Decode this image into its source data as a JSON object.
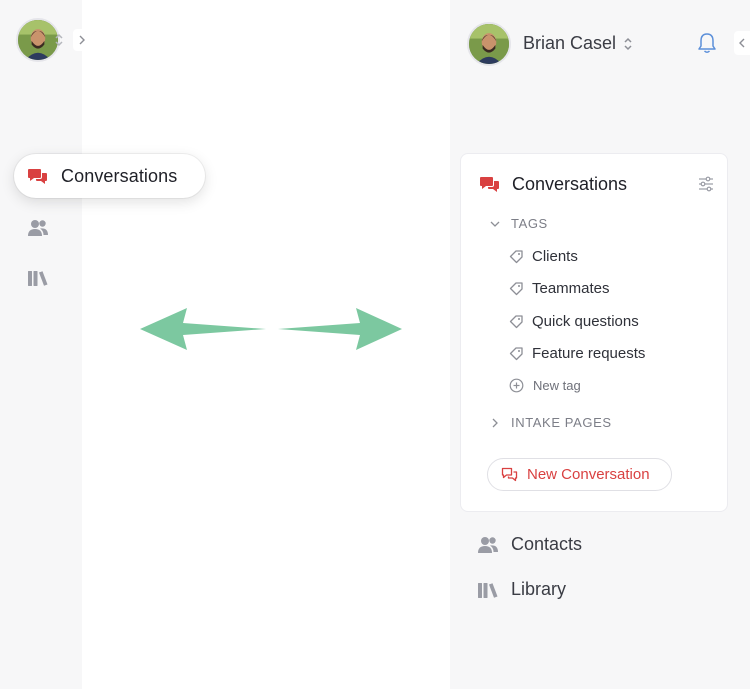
{
  "collapsed_sidebar": {
    "active_item": {
      "label": "Conversations",
      "icon": "conversations-icon"
    },
    "items": [
      {
        "icon": "contacts-icon"
      },
      {
        "icon": "library-icon"
      }
    ]
  },
  "expanded_sidebar": {
    "user": {
      "name": "Brian Casel"
    },
    "conversations": {
      "title": "Conversations",
      "tags_section": {
        "label": "TAGS",
        "items": [
          {
            "label": "Clients"
          },
          {
            "label": "Teammates"
          },
          {
            "label": "Quick questions"
          },
          {
            "label": "Feature requests"
          }
        ],
        "new_tag_label": "New tag"
      },
      "intake_section": {
        "label": "INTAKE PAGES"
      },
      "new_conversation_label": "New Conversation"
    },
    "nav": [
      {
        "label": "Contacts",
        "icon": "contacts-icon"
      },
      {
        "label": "Library",
        "icon": "library-icon"
      }
    ]
  },
  "colors": {
    "accent_red": "#d94141",
    "arrow_green": "#7cc8a0",
    "sidebar_bg": "#f7f7f8",
    "icon_gray": "#9a9ca5"
  }
}
